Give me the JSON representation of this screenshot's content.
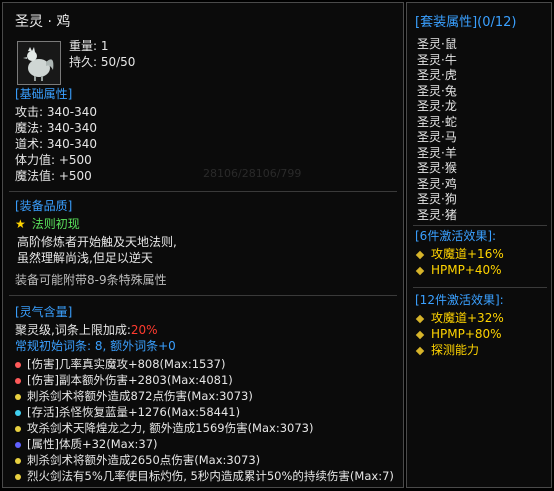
{
  "item": {
    "name": "圣灵 · 鸡",
    "weight_label": "重量: 1",
    "durability_label": "持久: 50/50",
    "base_attr_header": "[基础属性]",
    "base_attrs": [
      "攻击: 340-340",
      "魔法: 340-340",
      "道术: 340-340",
      "体力值: +500",
      "魔法值: +500"
    ],
    "watermark": "28106/28106/799",
    "quality_header": "[装备品质]",
    "quality_name": "法则初现",
    "quality_desc_1": "高阶修炼者开始触及天地法则,",
    "quality_desc_2": "虽然理解尚浅,但足以逆天",
    "quality_note": "装备可能附带8-9条特殊属性",
    "spirit_header": "[灵气含量]",
    "spirit_line_prefix": "聚灵级,词条上限加成:",
    "spirit_line_value": "20%",
    "affix_count": "常规初始词条: 8, 额外词条+0",
    "affixes": [
      {
        "color": "#ff5a5a",
        "text": "[伤害]几率真实魔攻+808(Max:1537)"
      },
      {
        "color": "#ff5a5a",
        "text": "[伤害]副本额外伤害+2803(Max:4081)"
      },
      {
        "color": "#e8d040",
        "text": "刺杀剑术将额外造成872点伤害(Max:3073)"
      },
      {
        "color": "#40d0f0",
        "text": "[存活]杀怪恢复蓝量+1276(Max:58441)"
      },
      {
        "color": "#e8d040",
        "text": "攻杀剑术天降煌龙之力, 额外造成1569伤害(Max:3073)"
      },
      {
        "color": "#6060ff",
        "text": "[属性]体质+32(Max:37)"
      },
      {
        "color": "#e8d040",
        "text": "刺杀剑术将额外造成2650点伤害(Max:3073)"
      },
      {
        "color": "#e8d040",
        "text": "烈火剑法有5%几率使目标灼伤, 5秒内造成累计50%的持续伤害(Max:7)"
      }
    ]
  },
  "set": {
    "header": "[套装属性](0/12)",
    "members": [
      "圣灵·鼠",
      "圣灵·牛",
      "圣灵·虎",
      "圣灵·兔",
      "圣灵·龙",
      "圣灵·蛇",
      "圣灵·马",
      "圣灵·羊",
      "圣灵·猴",
      "圣灵·鸡",
      "圣灵·狗",
      "圣灵·猪"
    ],
    "bonus6_header": "[6件激活效果]:",
    "bonus6": [
      "攻魔道+16%",
      "HPMP+40%"
    ],
    "bonus12_header": "[12件激活效果]:",
    "bonus12": [
      "攻魔道+32%",
      "HPMP+80%",
      "探测能力"
    ]
  }
}
